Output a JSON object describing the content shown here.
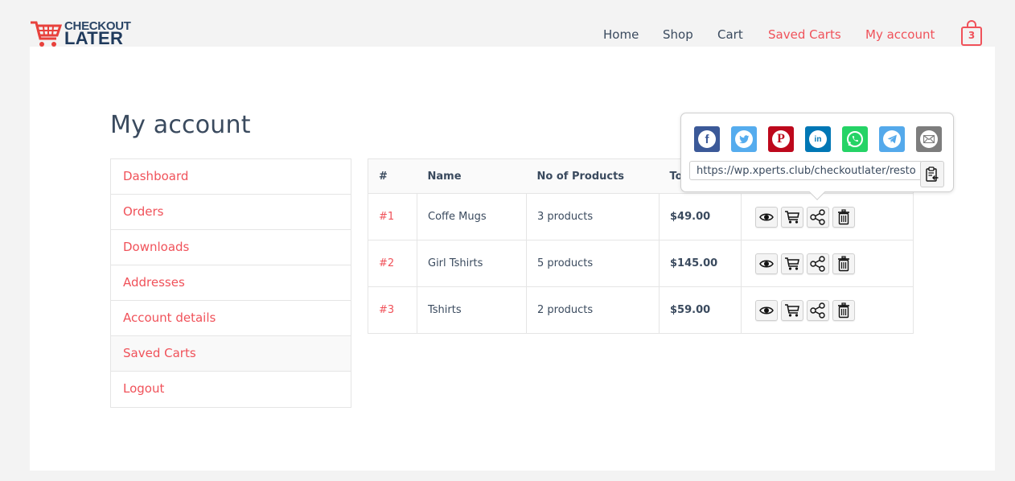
{
  "brand": {
    "line1": "CHECKOUT",
    "line2": "LATER",
    "accent_color": "#f0525a",
    "navy_color": "#1f3a5c"
  },
  "nav": {
    "items": [
      {
        "label": "Home",
        "active": false
      },
      {
        "label": "Shop",
        "active": false
      },
      {
        "label": "Cart",
        "active": false
      },
      {
        "label": "Saved Carts",
        "active": true
      },
      {
        "label": "My account",
        "active": true
      }
    ],
    "cart_count": "3",
    "cart_icon": "shopping-bag-icon"
  },
  "page": {
    "title": "My account"
  },
  "account_nav": {
    "items": [
      {
        "label": "Dashboard"
      },
      {
        "label": "Orders"
      },
      {
        "label": "Downloads"
      },
      {
        "label": "Addresses"
      },
      {
        "label": "Account details"
      },
      {
        "label": "Saved Carts",
        "current": true
      },
      {
        "label": "Logout"
      }
    ]
  },
  "table": {
    "headers": [
      "#",
      "Name",
      "No of Products",
      "Total",
      ""
    ],
    "rows": [
      {
        "id": "#1",
        "name": "Coffe Mugs",
        "products": "3 products",
        "total": "$49.00"
      },
      {
        "id": "#2",
        "name": "Girl Tshirts",
        "products": "5 products",
        "total": "$145.00"
      },
      {
        "id": "#3",
        "name": "Tshirts",
        "products": "2 products",
        "total": "$59.00"
      }
    ],
    "actions": [
      "view-eye-icon",
      "restore-cart-icon",
      "share-icon",
      "delete-trash-icon"
    ]
  },
  "share_popover": {
    "networks": [
      {
        "name": "facebook",
        "color": "#3b5998"
      },
      {
        "name": "twitter",
        "color": "#55acee"
      },
      {
        "name": "pinterest",
        "color": "#bd081c"
      },
      {
        "name": "linkedin",
        "color": "#0077b5"
      },
      {
        "name": "whatsapp",
        "color": "#25d366"
      },
      {
        "name": "telegram",
        "color": "#54a9eb"
      },
      {
        "name": "email",
        "color": "#7d7d7d"
      }
    ],
    "url": "https://wp.xperts.club/checkoutlater/restore",
    "copy_icon": "clipboard-copy-icon"
  }
}
